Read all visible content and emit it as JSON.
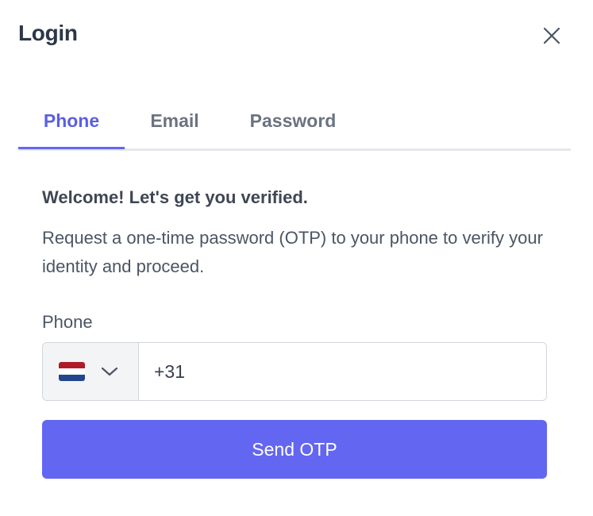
{
  "dialog": {
    "title": "Login",
    "close_icon": "close-icon"
  },
  "tabs": [
    {
      "label": "Phone",
      "active": true
    },
    {
      "label": "Email",
      "active": false
    },
    {
      "label": "Password",
      "active": false
    }
  ],
  "content": {
    "welcome": "Welcome! Let's get you verified.",
    "description": "Request a one-time password (OTP) to your phone to verify your identity and proceed."
  },
  "phone_field": {
    "label": "Phone",
    "country_flag": "netherlands-flag-icon",
    "value": "+31"
  },
  "send_button": {
    "label": "Send OTP"
  },
  "colors": {
    "accent": "#6366f1",
    "active_tab_text": "#5b5fe0",
    "title": "#2d3748",
    "flag_red": "#ae1c28",
    "flag_white": "#ffffff",
    "flag_blue": "#21468b"
  }
}
